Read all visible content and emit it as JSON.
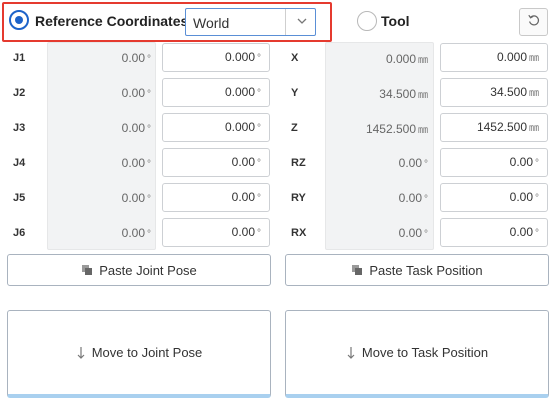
{
  "header": {
    "reference_label": "Reference Coordinates",
    "reference_selected": true,
    "coordinate_frame": "World",
    "tool_label": "Tool",
    "tool_selected": false,
    "highlight_color": "#e53a2f",
    "accent_color": "#1d63c9"
  },
  "joints": [
    {
      "label": "J1",
      "current": "0.00",
      "target": "0.000",
      "unit": "°"
    },
    {
      "label": "J2",
      "current": "0.00",
      "target": "0.000",
      "unit": "°"
    },
    {
      "label": "J3",
      "current": "0.00",
      "target": "0.000",
      "unit": "°"
    },
    {
      "label": "J4",
      "current": "0.00",
      "target": "0.00",
      "unit": "°"
    },
    {
      "label": "J5",
      "current": "0.00",
      "target": "0.00",
      "unit": "°"
    },
    {
      "label": "J6",
      "current": "0.00",
      "target": "0.00",
      "unit": "°"
    }
  ],
  "task": [
    {
      "label": "X",
      "current": "0.000",
      "target": "0.000",
      "unit": "㎜"
    },
    {
      "label": "Y",
      "current": "34.500",
      "target": "34.500",
      "unit": "㎜"
    },
    {
      "label": "Z",
      "current": "1452.500",
      "target": "1452.500",
      "unit": "㎜"
    },
    {
      "label": "RZ",
      "current": "0.00",
      "target": "0.00",
      "unit": "°"
    },
    {
      "label": "RY",
      "current": "0.00",
      "target": "0.00",
      "unit": "°"
    },
    {
      "label": "RX",
      "current": "0.00",
      "target": "0.00",
      "unit": "°"
    }
  ],
  "buttons": {
    "paste_joint": "Paste Joint Pose",
    "paste_task": "Paste Task Position",
    "move_joint": "Move to Joint Pose",
    "move_task": "Move to Task Position"
  }
}
